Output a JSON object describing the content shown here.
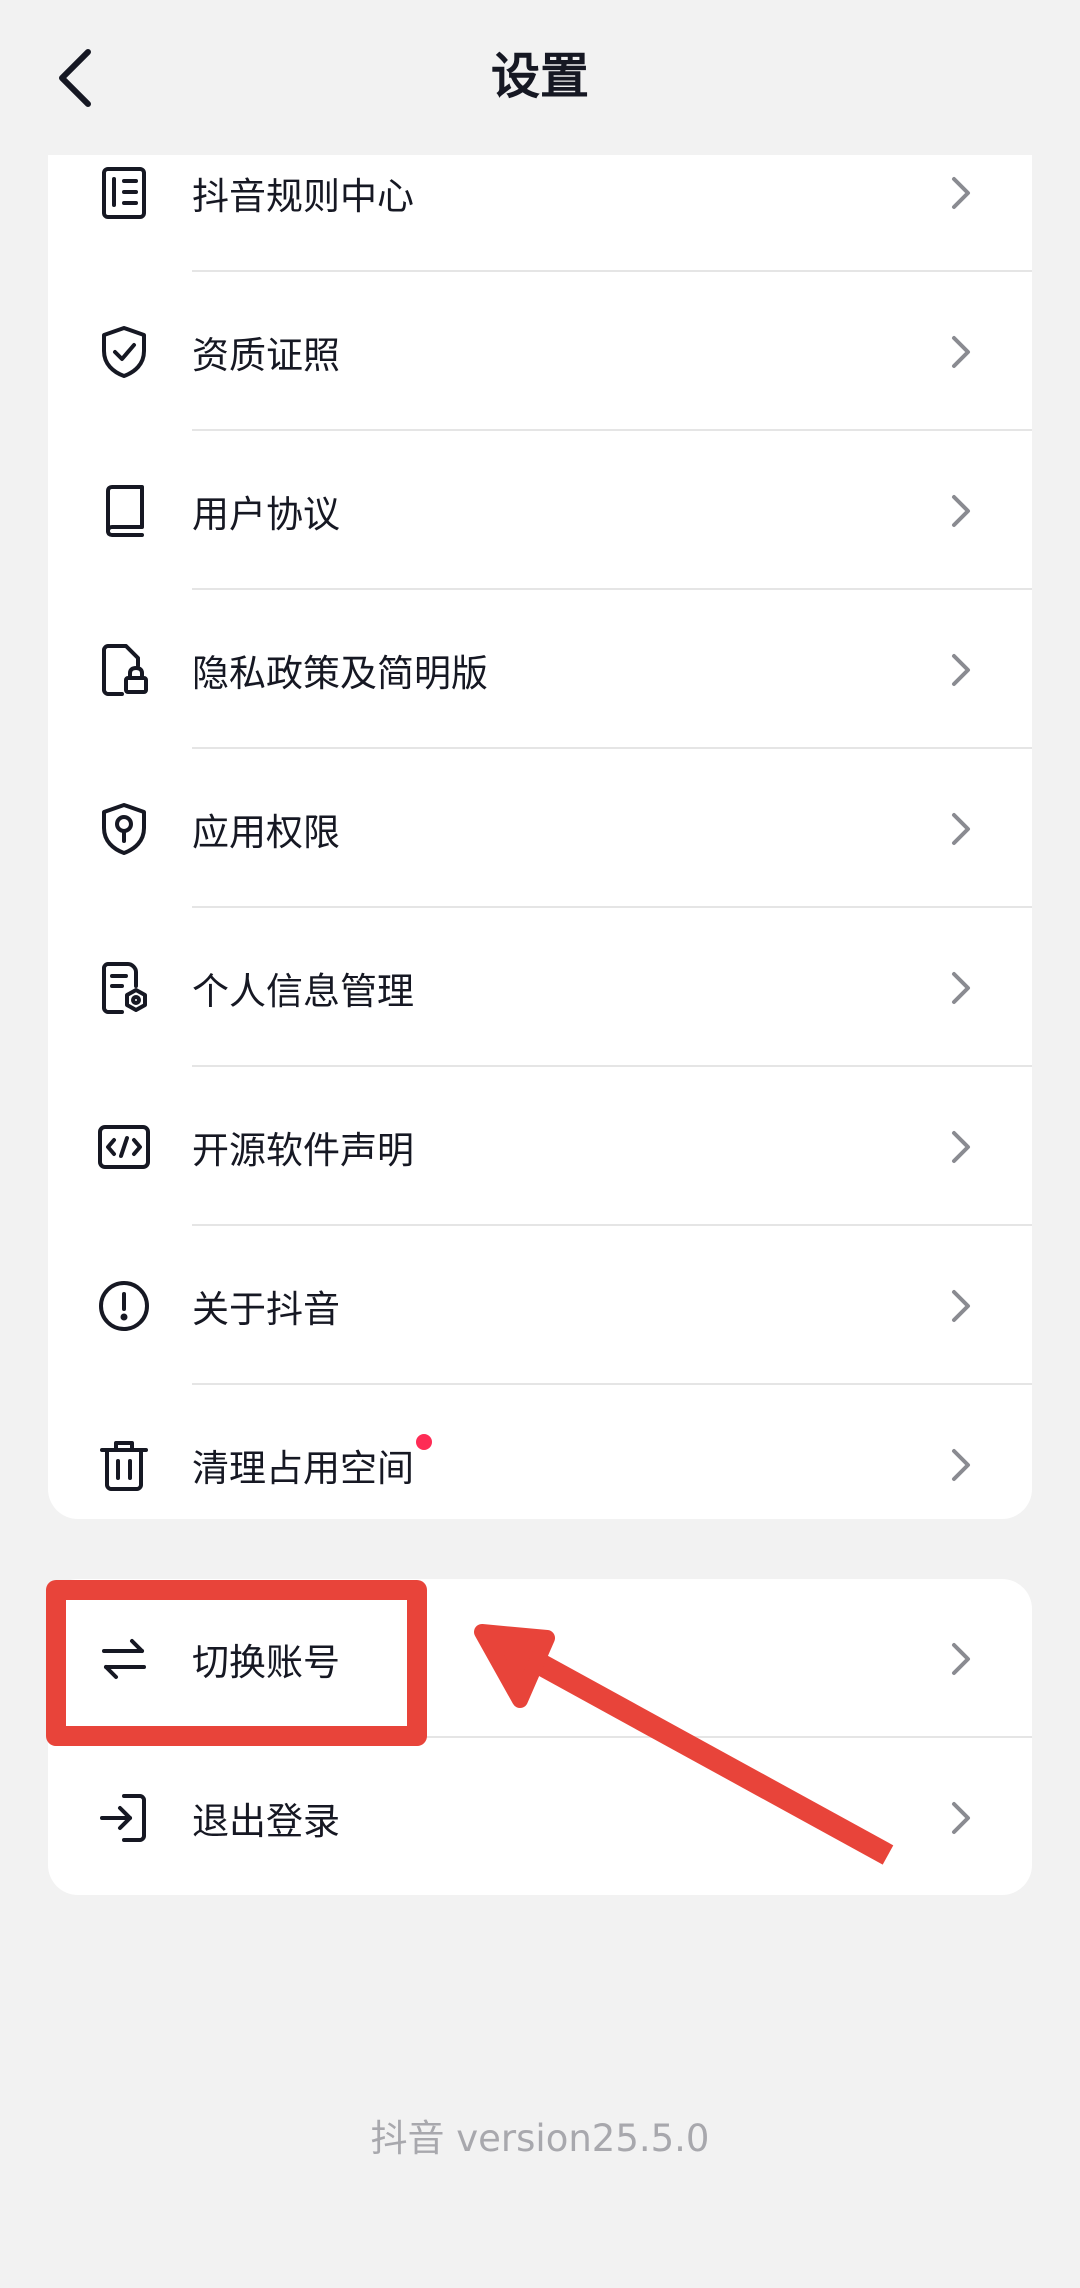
{
  "header": {
    "title": "设置"
  },
  "menu_group_1": [
    {
      "icon": "document-list-icon",
      "label": "抖音规则中心"
    },
    {
      "icon": "shield-check-icon",
      "label": "资质证照"
    },
    {
      "icon": "book-icon",
      "label": "用户协议"
    },
    {
      "icon": "privacy-lock-icon",
      "label": "隐私政策及简明版"
    },
    {
      "icon": "shield-key-icon",
      "label": "应用权限"
    },
    {
      "icon": "personal-info-settings-icon",
      "label": "个人信息管理"
    },
    {
      "icon": "code-icon",
      "label": "开源软件声明"
    },
    {
      "icon": "info-exclamation-icon",
      "label": "关于抖音"
    },
    {
      "icon": "trash-icon",
      "label": "清理占用空间",
      "badge": "red-dot"
    }
  ],
  "menu_group_2": [
    {
      "icon": "switch-arrows-icon",
      "label": "切换账号"
    },
    {
      "icon": "logout-icon",
      "label": "退出登录"
    }
  ],
  "footer": {
    "version_text": "抖音 version25.5.0"
  },
  "colors": {
    "annotation_red": "#e8443a",
    "badge_red": "#fe2c55",
    "text": "#161823"
  }
}
